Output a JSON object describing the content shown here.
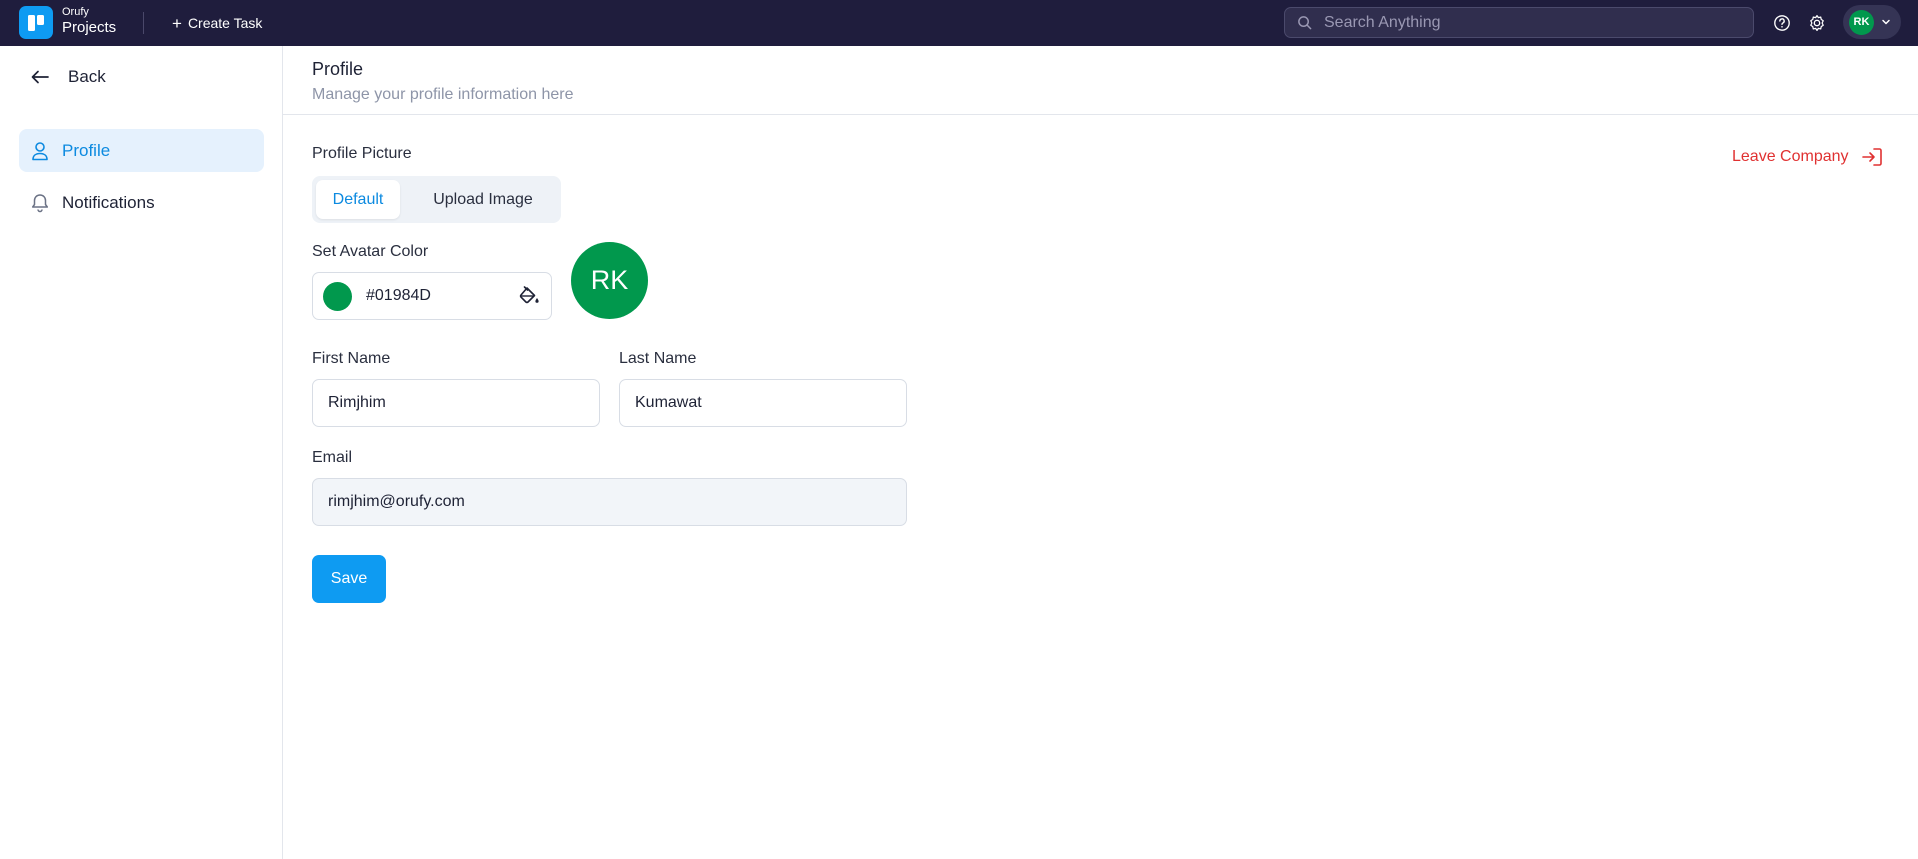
{
  "app": {
    "brand_small": "Orufy",
    "brand_big": "Projects",
    "logo_icon": "board-icon"
  },
  "topbar": {
    "create_task_label": "Create Task",
    "search_placeholder": "Search Anything",
    "help_icon": "help-circle-icon",
    "settings_icon": "gear-icon",
    "user_initials": "RK"
  },
  "sidebar": {
    "back_label": "Back",
    "items": [
      {
        "label": "Profile",
        "icon": "user-icon",
        "active": true
      },
      {
        "label": "Notifications",
        "icon": "bell-icon",
        "active": false
      }
    ]
  },
  "header": {
    "title": "Profile",
    "subtitle": "Manage your profile information here"
  },
  "profile_picture": {
    "label": "Profile Picture",
    "options": [
      "Default",
      "Upload Image"
    ],
    "selected": "Default"
  },
  "avatar_color": {
    "label": "Set Avatar Color",
    "value": "#01984D",
    "initials": "RK"
  },
  "form": {
    "first_name_label": "First Name",
    "first_name_value": "Rimjhim",
    "last_name_label": "Last Name",
    "last_name_value": "Kumawat",
    "email_label": "Email",
    "email_value": "rimjhim@orufy.com"
  },
  "actions": {
    "save_label": "Save",
    "leave_label": "Leave Company"
  },
  "colors": {
    "topbar_bg": "#1f1d3d",
    "accent": "#0e9bf2",
    "avatar": "#01984d",
    "danger": "#e03131"
  }
}
